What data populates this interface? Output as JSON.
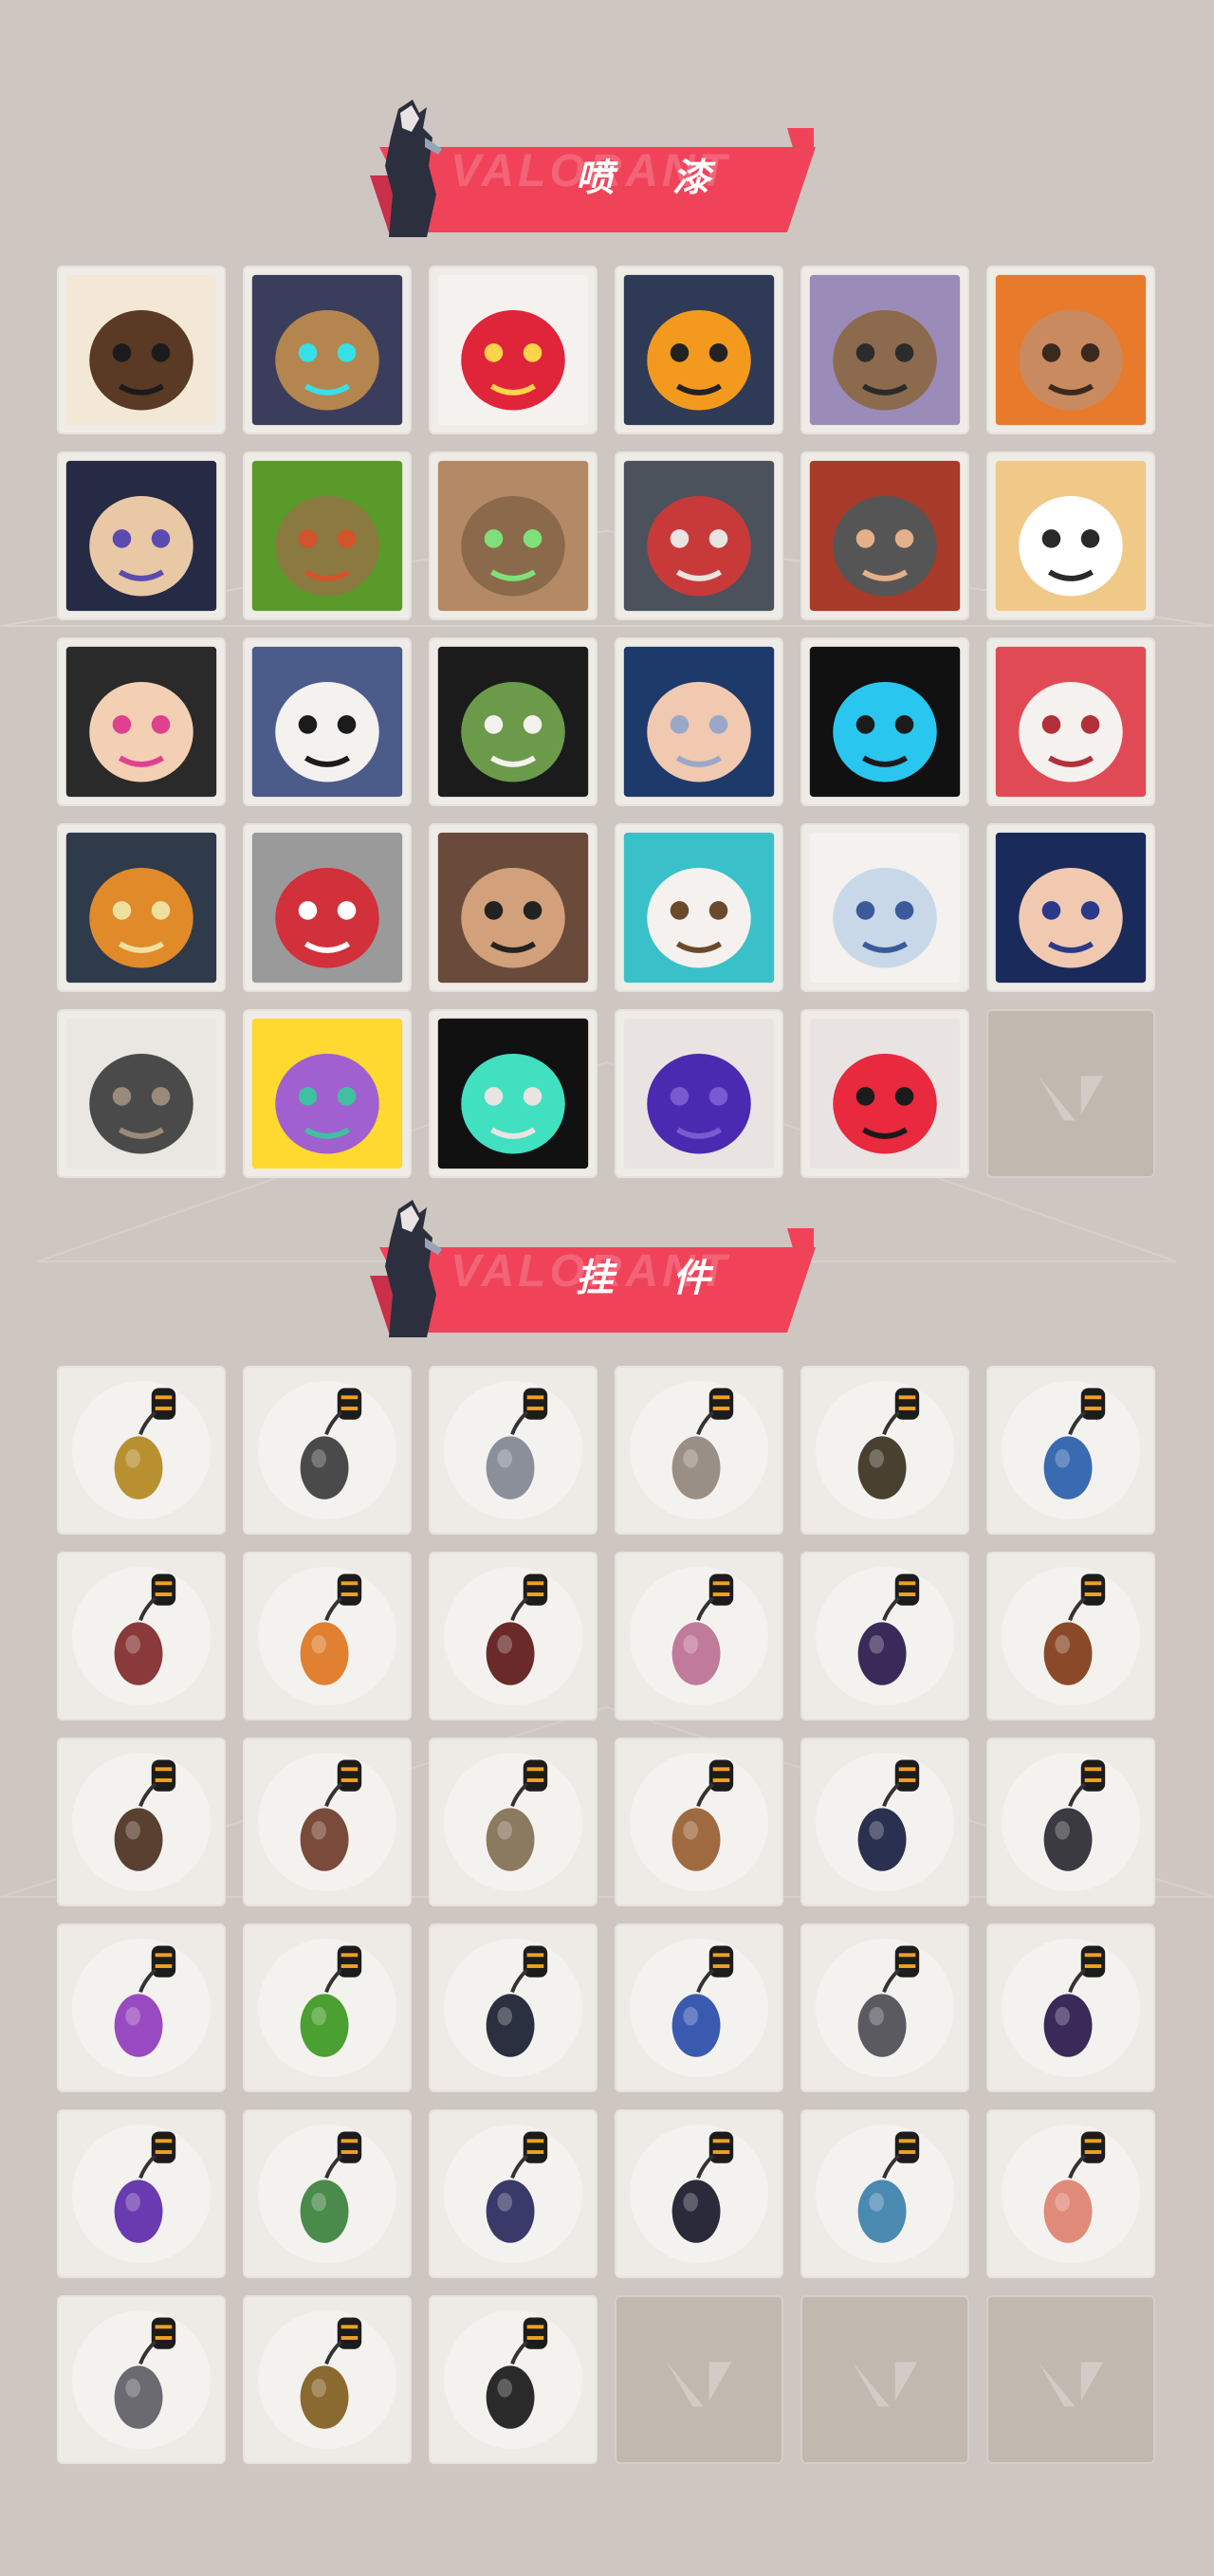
{
  "sections": {
    "sprays": {
      "title": "喷 漆",
      "watermark": "VALORANT"
    },
    "charms": {
      "title": "挂 件",
      "watermark": "VALORANT"
    }
  },
  "colors": {
    "accent": "#f0435a",
    "background": "#cec6c1",
    "tile": "#efece8",
    "empty_tile": "#c1b8b0"
  },
  "sprays": [
    {
      "icon": "mohawk-agent-pixel-spray-icon"
    },
    {
      "icon": "armored-robot-face-spray-icon"
    },
    {
      "icon": "clown-face-spray-icon"
    },
    {
      "icon": "orange-dial-device-spray-icon"
    },
    {
      "icon": "sunglasses-bear-spray-icon"
    },
    {
      "icon": "bearded-agent-grin-spray-icon"
    },
    {
      "icon": "bandaged-boy-face-spray-icon"
    },
    {
      "icon": "green-crate-spray-icon"
    },
    {
      "icon": "green-eyed-creature-spray-icon"
    },
    {
      "icon": "crying-creature-spray-icon"
    },
    {
      "icon": "red-blade-spray-icon"
    },
    {
      "icon": "laughing-tiger-spray-icon"
    },
    {
      "icon": "angry-girl-pencil-spray-icon"
    },
    {
      "icon": "beanie-penguin-spray-icon"
    },
    {
      "icon": "frog-hat-spray-icon"
    },
    {
      "icon": "hooded-agent-spray-icon"
    },
    {
      "icon": "cyan-shapes-spray-icon"
    },
    {
      "icon": "number-ten-spray-icon"
    },
    {
      "icon": "duck-beak-spray-icon"
    },
    {
      "icon": "red-cross-button-spray-icon"
    },
    {
      "icon": "pixel-cat-shades-spray-icon"
    },
    {
      "icon": "wave-bear-spray-icon"
    },
    {
      "icon": "white-hair-agent-spray-icon"
    },
    {
      "icon": "dark-hair-agent-spray-icon"
    },
    {
      "icon": "catfish-spray-icon"
    },
    {
      "icon": "yellow-jacket-agent-spray-icon"
    },
    {
      "icon": "valorant-logo-teal-spray-icon"
    },
    {
      "icon": "purple-graffiti-spray-icon"
    },
    {
      "icon": "red-valorant-emblem-spray-icon"
    },
    {
      "icon": "empty-slot-icon",
      "empty": true
    }
  ],
  "charms": [
    {
      "icon": "gold-cat-charm-icon"
    },
    {
      "icon": "robot-orb-charm-icon"
    },
    {
      "icon": "mini-bed-charm-icon"
    },
    {
      "icon": "raccoon-figure-charm-icon"
    },
    {
      "icon": "round-pouch-charm-icon"
    },
    {
      "icon": "blue-canister-charm-icon"
    },
    {
      "icon": "spiked-sword-charm-icon"
    },
    {
      "icon": "orange-pepper-charm-icon"
    },
    {
      "icon": "braided-cord-charm-icon"
    },
    {
      "icon": "cupcake-charm-icon"
    },
    {
      "icon": "ep9-medallion-charm-icon"
    },
    {
      "icon": "bear-bell-charm-icon"
    },
    {
      "icon": "brown-gadget-charm-icon"
    },
    {
      "icon": "agent-figure-charm-icon"
    },
    {
      "icon": "hat-figure-charm-icon"
    },
    {
      "icon": "leather-box-charm-icon"
    },
    {
      "icon": "dark-creature-charm-icon"
    },
    {
      "icon": "metal-claw-charm-icon"
    },
    {
      "icon": "lava-lamp-charm-icon"
    },
    {
      "icon": "green-pager-charm-icon"
    },
    {
      "icon": "sneaker-charm-icon"
    },
    {
      "icon": "astronaut-charm-icon"
    },
    {
      "icon": "walkie-talkie-charm-icon"
    },
    {
      "icon": "ep9-token-charm-icon"
    },
    {
      "icon": "pixel-heart-charm-icon"
    },
    {
      "icon": "green-can-charm-icon"
    },
    {
      "icon": "purple-lantern-charm-icon"
    },
    {
      "icon": "ep9-tag-charm-icon"
    },
    {
      "icon": "ufo-charm-icon"
    },
    {
      "icon": "koi-fish-charm-icon"
    },
    {
      "icon": "grey-cat-head-charm-icon"
    },
    {
      "icon": "gold-coin-charm-icon"
    },
    {
      "icon": "valorant-tag-charm-icon"
    },
    {
      "icon": "empty-slot-icon",
      "empty": true
    },
    {
      "icon": "empty-slot-icon",
      "empty": true
    },
    {
      "icon": "empty-slot-icon",
      "empty": true
    }
  ]
}
